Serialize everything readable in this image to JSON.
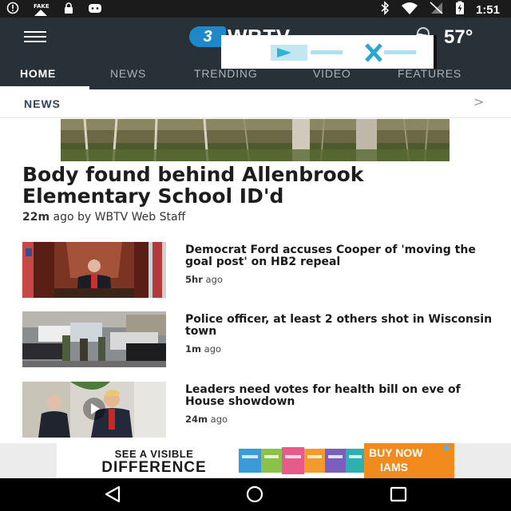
{
  "status_bar": {
    "time": "1:51",
    "left_icons": [
      "alert-circle-icon",
      "fake-notification-icon",
      "lock-icon",
      "game-controller-icon"
    ],
    "fake_label": "FAKE",
    "right_icons": [
      "bluetooth-icon",
      "wifi-icon",
      "cell-signal-off-icon",
      "battery-charging-icon"
    ]
  },
  "header": {
    "logo": {
      "badge": "3",
      "text": "WBTV"
    },
    "weather": {
      "icon": "partly-cloudy-icon",
      "temperature": "57°"
    },
    "tabs": [
      {
        "label": "HOME",
        "active": true
      },
      {
        "label": "NEWS",
        "active": false
      },
      {
        "label": "TRENDING",
        "active": false
      },
      {
        "label": "VIDEO",
        "active": false
      },
      {
        "label": "FEATURES",
        "active": false
      }
    ]
  },
  "section": {
    "title": "NEWS",
    "chevron": ">"
  },
  "hero": {
    "headline": "Body found behind Allenbrook Elementary School ID'd",
    "time": "22m",
    "meta_rest": " ago by WBTV Web Staff"
  },
  "stories": [
    {
      "title": "Democrat Ford accuses Cooper of 'moving the goal post' on HB2 repeal",
      "time": "5hr",
      "ago": " ago"
    },
    {
      "title": "Police officer, at least 2 others shot in Wisconsin town",
      "time": "1m",
      "ago": " ago"
    },
    {
      "title": "Leaders need votes for health bill on eve of House showdown",
      "time": "24m",
      "ago": " ago"
    }
  ],
  "bottom_ad": {
    "line1": "SEE A VISIBLE",
    "line2": "DIFFERENCE",
    "cta": "BUY NOW",
    "brand": "IAMS",
    "colors": {
      "cta": "#f28a1e"
    }
  },
  "nav": {
    "buttons": [
      "back-icon",
      "home-icon",
      "recents-icon"
    ]
  },
  "colors": {
    "header": "#293138",
    "status_bar": "#1b1b1b",
    "section_title": "#2d4360"
  }
}
